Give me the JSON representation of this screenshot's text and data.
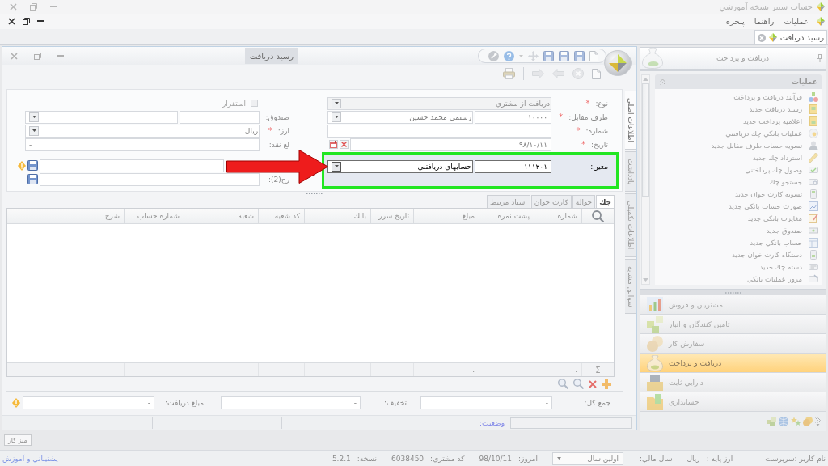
{
  "app_window": {
    "title": "حساب سنتر نسخه آموزشي"
  },
  "menu": [
    {
      "label": "عمليات"
    },
    {
      "label": "راهنما"
    },
    {
      "label": "پنجره"
    }
  ],
  "document_tabs": [
    {
      "label": "رسيد دريافت",
      "selected": true
    }
  ],
  "receipt_window": {
    "title": "رسيد دريافت",
    "side_tabs": [
      {
        "label": "اطلاعات اصلي",
        "selected": true
      },
      {
        "label": "يادداشت",
        "selected": false
      },
      {
        "label": "اطلاعات تكميلي",
        "selected": false
      },
      {
        "label": "سوابق مشابه",
        "selected": false
      }
    ],
    "main_fields": [
      {
        "kind": "combo",
        "label": "نوع:",
        "mark": "*",
        "value": "دريافت از مشتري",
        "disabled": true,
        "highlighted": false
      },
      {
        "kind": "code_combo",
        "label": "طرف مقابل:",
        "mark": "*",
        "code": "۱۰۰۰۰",
        "value": "رستمي محمد حسين",
        "disabled": false,
        "highlighted": false
      },
      {
        "kind": "text",
        "label": "شماره:",
        "mark": "*",
        "disabled": false,
        "highlighted": false
      },
      {
        "kind": "date",
        "label": "تاريخ:",
        "mark": "*",
        "value": "۹۸/۱۰/۱۱",
        "disabled": false,
        "highlighted": false
      },
      {
        "kind": "code_combo",
        "label": "معين:",
        "code": "۱۱۱۲۰۱",
        "value": "حسابهاي دريافتني",
        "disabled": false,
        "highlighted": true
      }
    ],
    "side_fields": [
      {
        "kind": "checkbox",
        "label": "استقرار",
        "checked": false,
        "disabled": true
      },
      {
        "kind": "text_combo",
        "label": "صندوق:"
      },
      {
        "kind": "combo",
        "label": "ارز:",
        "mark": "*",
        "value": "ريال"
      },
      {
        "kind": "amount",
        "label": "لغ نقد:",
        "value": "-"
      },
      {
        "kind": "memo",
        "alert": true
      },
      {
        "kind": "memo",
        "label": "رح(2):",
        "alert": false
      }
    ],
    "grid": {
      "tabs": [
        {
          "label": "چك",
          "selected": true
        },
        {
          "label": "حواله",
          "selected": false
        },
        {
          "label": "كارت خوان",
          "selected": false
        },
        {
          "label": "اسناد مرتبط",
          "selected": false
        }
      ],
      "columns": [
        {
          "title": "شماره",
          "sum": "."
        },
        {
          "title": "پشت نمره"
        },
        {
          "title": "مبلغ",
          "sum": "."
        },
        {
          "title": "تاريخ سرر..."
        },
        {
          "title": "بانك"
        },
        {
          "title": "كد شعبه"
        },
        {
          "title": "شعبه"
        },
        {
          "title": "شماره حساب"
        },
        {
          "title": "شرح"
        }
      ],
      "sum_symbol": "Σ"
    },
    "totals": [
      {
        "label": "جمع كل:",
        "value": "-",
        "alert": false
      },
      {
        "label": "تخفيف:",
        "value": "-",
        "alert": false
      },
      {
        "label": "مبلغ دريافت:",
        "value": "-",
        "alert": true
      }
    ],
    "status": {
      "label": "وضعيت:"
    }
  },
  "sidebar": {
    "title": "دريافت و پرداخت",
    "group": {
      "title": "عمليات",
      "expanded": true,
      "items": [
        {
          "label": "فرآيند دريافت و پرداخت"
        },
        {
          "label": "رسيد دريافت جديد"
        },
        {
          "label": "اعلاميه پرداخت جديد"
        },
        {
          "label": "عمليات بانكي چك دريافتني"
        },
        {
          "label": "تسويه حساب طرف مقابل جديد"
        },
        {
          "label": "استرداد چك جديد"
        },
        {
          "label": "وصول چك پرداختني"
        },
        {
          "label": "جستجو چك"
        },
        {
          "label": "تسويه كارت خوان جديد"
        },
        {
          "label": "صورت حساب بانكي جديد"
        },
        {
          "label": "مغايرت بانكي جديد"
        },
        {
          "label": "صندوق جديد"
        },
        {
          "label": "حساب بانكي جديد"
        },
        {
          "label": "دستگاه كارت خوان جديد"
        },
        {
          "label": "دسته چك جديد"
        },
        {
          "label": "مرور عمليات بانكي"
        }
      ]
    },
    "modules": [
      {
        "label": "مشتريان و فروش",
        "selected": false
      },
      {
        "label": "تامين كنندگان و انبار",
        "selected": false
      },
      {
        "label": "سفارش كار",
        "selected": false
      },
      {
        "label": "دريافت و پرداخت",
        "selected": true
      },
      {
        "label": "دارايي ثابت",
        "selected": false
      },
      {
        "label": "حسابداري",
        "selected": false
      }
    ]
  },
  "desktop_button": {
    "label": "ميز كار"
  },
  "status_bar": {
    "user": "نام كاربر :سرپرست",
    "currency_label": "ارز پايه :",
    "currency": "ريال",
    "year_label": "سال مالي:",
    "year": "اولين سال",
    "today_label": "امروز:",
    "today": "98/10/11",
    "customer_label": "كد مشتري:",
    "customer": "6038450",
    "version_label": "نسخه:",
    "version": "5.2.1",
    "support_link": "پشتيباني و آموزش"
  }
}
